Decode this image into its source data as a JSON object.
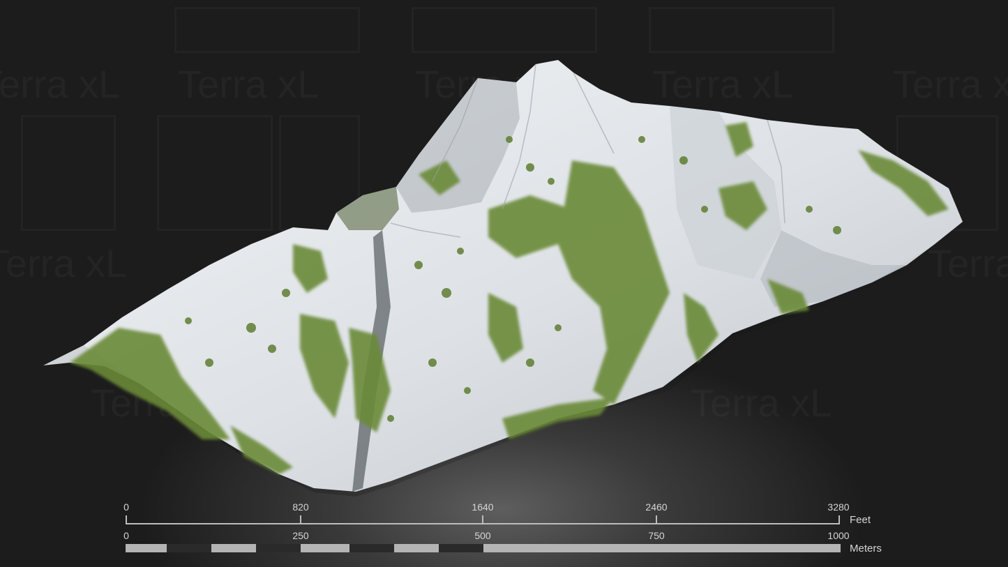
{
  "watermark": {
    "text": "Terra xL"
  },
  "image": {
    "icon": "mountain-terrain-model",
    "colors": {
      "rock": "#e4e7ea",
      "vegetation": "#6f8f3a",
      "shadow": "#8b9196"
    }
  },
  "scale_bar": {
    "feet": {
      "ticks": [
        "0",
        "820",
        "1640",
        "2460",
        "3280"
      ],
      "unit": "Feet"
    },
    "meters": {
      "ticks": [
        "0",
        "250",
        "500",
        "750",
        "1000"
      ],
      "unit": "Meters"
    },
    "colors": {
      "light": "#b4b4b4",
      "dark": "#2a2a2a"
    }
  }
}
